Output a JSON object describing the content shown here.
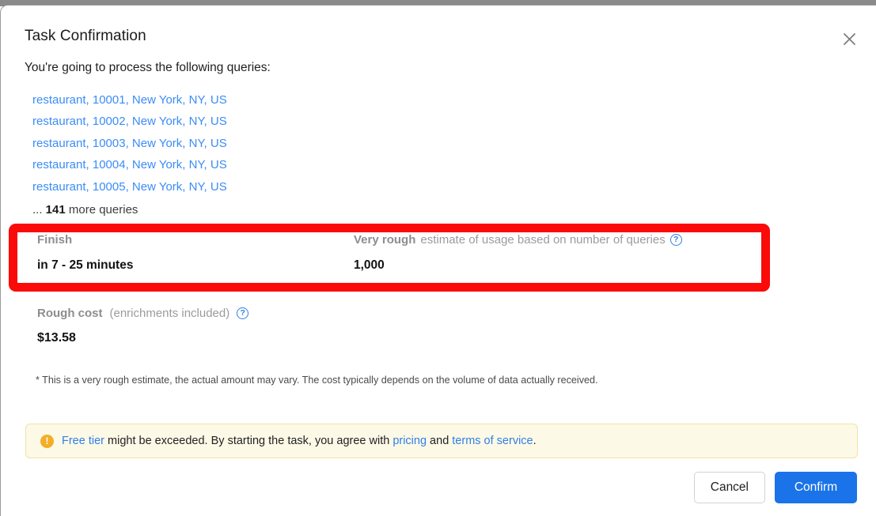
{
  "dialog": {
    "title": "Task Confirmation",
    "close_icon": "close-icon",
    "intro": "You're going to process the following queries:"
  },
  "queries": {
    "items": [
      "restaurant, 10001, New York, NY, US",
      "restaurant, 10002, New York, NY, US",
      "restaurant, 10003, New York, NY, US",
      "restaurant, 10004, New York, NY, US",
      "restaurant, 10005, New York, NY, US"
    ],
    "more_prefix": "... ",
    "more_count": "141",
    "more_suffix": " more queries"
  },
  "estimate": {
    "finish": {
      "label": "Finish",
      "value": "in 7 - 25 minutes"
    },
    "usage": {
      "label_strong": "Very rough",
      "label_rest": " estimate of usage based on number of queries",
      "help_icon": "help-circle-icon",
      "help_glyph": "?",
      "value": "1,000"
    }
  },
  "cost": {
    "label_strong": "Rough cost",
    "label_rest": "(enrichments included)",
    "help_icon": "help-circle-icon",
    "help_glyph": "?",
    "value": "$13.58"
  },
  "disclaimer": "* This is a very rough estimate, the actual amount may vary. The cost typically depends on the volume of data actually received.",
  "notice": {
    "warning_icon": "warning-icon",
    "warning_glyph": "!",
    "link_free_tier": "Free tier",
    "text_mid": " might be exceeded. By starting the task, you agree with ",
    "link_pricing": "pricing",
    "text_and": " and ",
    "link_terms": "terms of service",
    "text_end": "."
  },
  "footer": {
    "cancel_label": "Cancel",
    "confirm_label": "Confirm"
  },
  "colors": {
    "accent": "#1a73e8",
    "link": "#3b8cf5",
    "highlight": "#fb0a0a",
    "warning": "#f2ae27",
    "banner_bg": "#fdf9e7"
  }
}
